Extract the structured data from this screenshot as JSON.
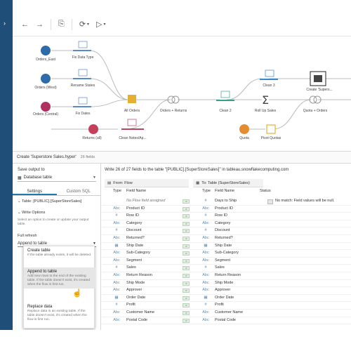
{
  "toolbar": {
    "back_icon": "arrow-left-icon",
    "forward_icon": "arrow-right-icon",
    "items": [
      "undo",
      "refresh",
      "run"
    ]
  },
  "flow": {
    "nodes": [
      {
        "id": "orders-east",
        "label": "Orders_East",
        "color": "#2e6ba8"
      },
      {
        "id": "orders-west",
        "label": "Orders (West)",
        "color": "#2e6ba8"
      },
      {
        "id": "orders-central",
        "label": "Orders (Central)",
        "color": "#b03060"
      },
      {
        "id": "returns-all",
        "label": "Returns (all)",
        "color": "#c4405a"
      },
      {
        "id": "fix-data-type",
        "label": "Fix Data Type",
        "color": "#5a88c8"
      },
      {
        "id": "rename-states",
        "label": "Rename States",
        "color": "#5a88c8"
      },
      {
        "id": "fix-dates",
        "label": "Fix Dates",
        "color": "#5a88c8"
      },
      {
        "id": "clean-notes",
        "label": "Clean Notes/Ap...",
        "color": "#c04060"
      },
      {
        "id": "all-orders",
        "label": "All Orders",
        "color": "#e5b030"
      },
      {
        "id": "orders-returns",
        "label": "Orders + Returns",
        "color": "#7c7c7c"
      },
      {
        "id": "clean-2",
        "label": "Clean 2",
        "color": "#3aa08a"
      },
      {
        "id": "roll-up-sales",
        "label": "Roll Up Sales",
        "color": "#555555"
      },
      {
        "id": "quota",
        "label": "Quota",
        "color": "#e58c30"
      },
      {
        "id": "clean-3",
        "label": "Clean 3",
        "color": "#3a88c8"
      },
      {
        "id": "pivot-quotas",
        "label": "Pivot Quotas",
        "color": "#e5b030"
      },
      {
        "id": "create-superstore",
        "label": "Create 'Supers...",
        "color": "#555555"
      },
      {
        "id": "quota-orders",
        "label": "Quota + Orders",
        "color": "#7c7c7c"
      }
    ]
  },
  "panel": {
    "title": "Create 'Superstore Sales.hyper'",
    "field_count": "26 fields"
  },
  "left": {
    "save_output_label": "Save output to",
    "save_output_value": "Database table",
    "tab_settings": "Settings",
    "tab_custom_sql": "Custom SQL",
    "table_label": "Table: [PUBLIC].[SuperStoreSales]",
    "write_options_label": "Write Options",
    "write_options_desc": "Select an option to create or update your output table.",
    "full_refresh": "Full refresh",
    "dropdown_value": "Append to table",
    "menu": [
      {
        "title": "Create table",
        "desc": "If the table already exists, it will be deleted."
      },
      {
        "title": "Append to table",
        "desc": "Add new rows to the end of the existing table. If the table doesn't exist, it's created when the flow is first run."
      },
      {
        "title": "Replace data",
        "desc": "Replace data in an existing table. If the table doesn't exist, it's created when the flow is first run."
      }
    ]
  },
  "right": {
    "header": "Write 26 of 27 fields to the table \"[PUBLIC].[SuperStoreSales]\" in tableau.snowflakecomputing.com",
    "from_label": "From: Flow",
    "to_label": "To: Table (SuperStoreSales)",
    "col_type": "Type",
    "col_field": "Field Name",
    "col_status": "Status",
    "rows": [
      {
        "from": "No Flow field assigned",
        "to": "Days to Ship",
        "status": "No match: Field values will be null.",
        "from_type": "",
        "to_type": "#"
      },
      {
        "from": "Product ID",
        "to": "Product ID",
        "status": "",
        "from_type": "Abc",
        "to_type": "Abc"
      },
      {
        "from": "Row ID",
        "to": "Row ID",
        "status": "",
        "from_type": "#",
        "to_type": "#"
      },
      {
        "from": "Category",
        "to": "Category",
        "status": "",
        "from_type": "Abc",
        "to_type": "Abc"
      },
      {
        "from": "Discount",
        "to": "Discount",
        "status": "",
        "from_type": "#",
        "to_type": "#"
      },
      {
        "from": "Returned?",
        "to": "Returned?",
        "status": "",
        "from_type": "Abc",
        "to_type": "Abc"
      },
      {
        "from": "Ship Date",
        "to": "Ship Date",
        "status": "",
        "from_type": "▦",
        "to_type": "▦"
      },
      {
        "from": "Sub-Category",
        "to": "Sub-Category",
        "status": "",
        "from_type": "Abc",
        "to_type": "Abc"
      },
      {
        "from": "Segment",
        "to": "Segment",
        "status": "",
        "from_type": "Abc",
        "to_type": "Abc"
      },
      {
        "from": "Sales",
        "to": "Sales",
        "status": "",
        "from_type": "#",
        "to_type": "#"
      },
      {
        "from": "Return Reason",
        "to": "Return Reason",
        "status": "",
        "from_type": "Abc",
        "to_type": "Abc"
      },
      {
        "from": "Ship Mode",
        "to": "Ship Mode",
        "status": "",
        "from_type": "Abc",
        "to_type": "Abc"
      },
      {
        "from": "Approver",
        "to": "Approver",
        "status": "",
        "from_type": "Abc",
        "to_type": "Abc"
      },
      {
        "from": "Order Date",
        "to": "Order Date",
        "status": "",
        "from_type": "▦",
        "to_type": "▦"
      },
      {
        "from": "Profit",
        "to": "Profit",
        "status": "",
        "from_type": "#",
        "to_type": "#"
      },
      {
        "from": "Customer Name",
        "to": "Customer Name",
        "status": "",
        "from_type": "Abc",
        "to_type": "Abc"
      },
      {
        "from": "Postal Code",
        "to": "Postal Code",
        "status": "",
        "from_type": "Abc",
        "to_type": "Abc"
      }
    ]
  }
}
